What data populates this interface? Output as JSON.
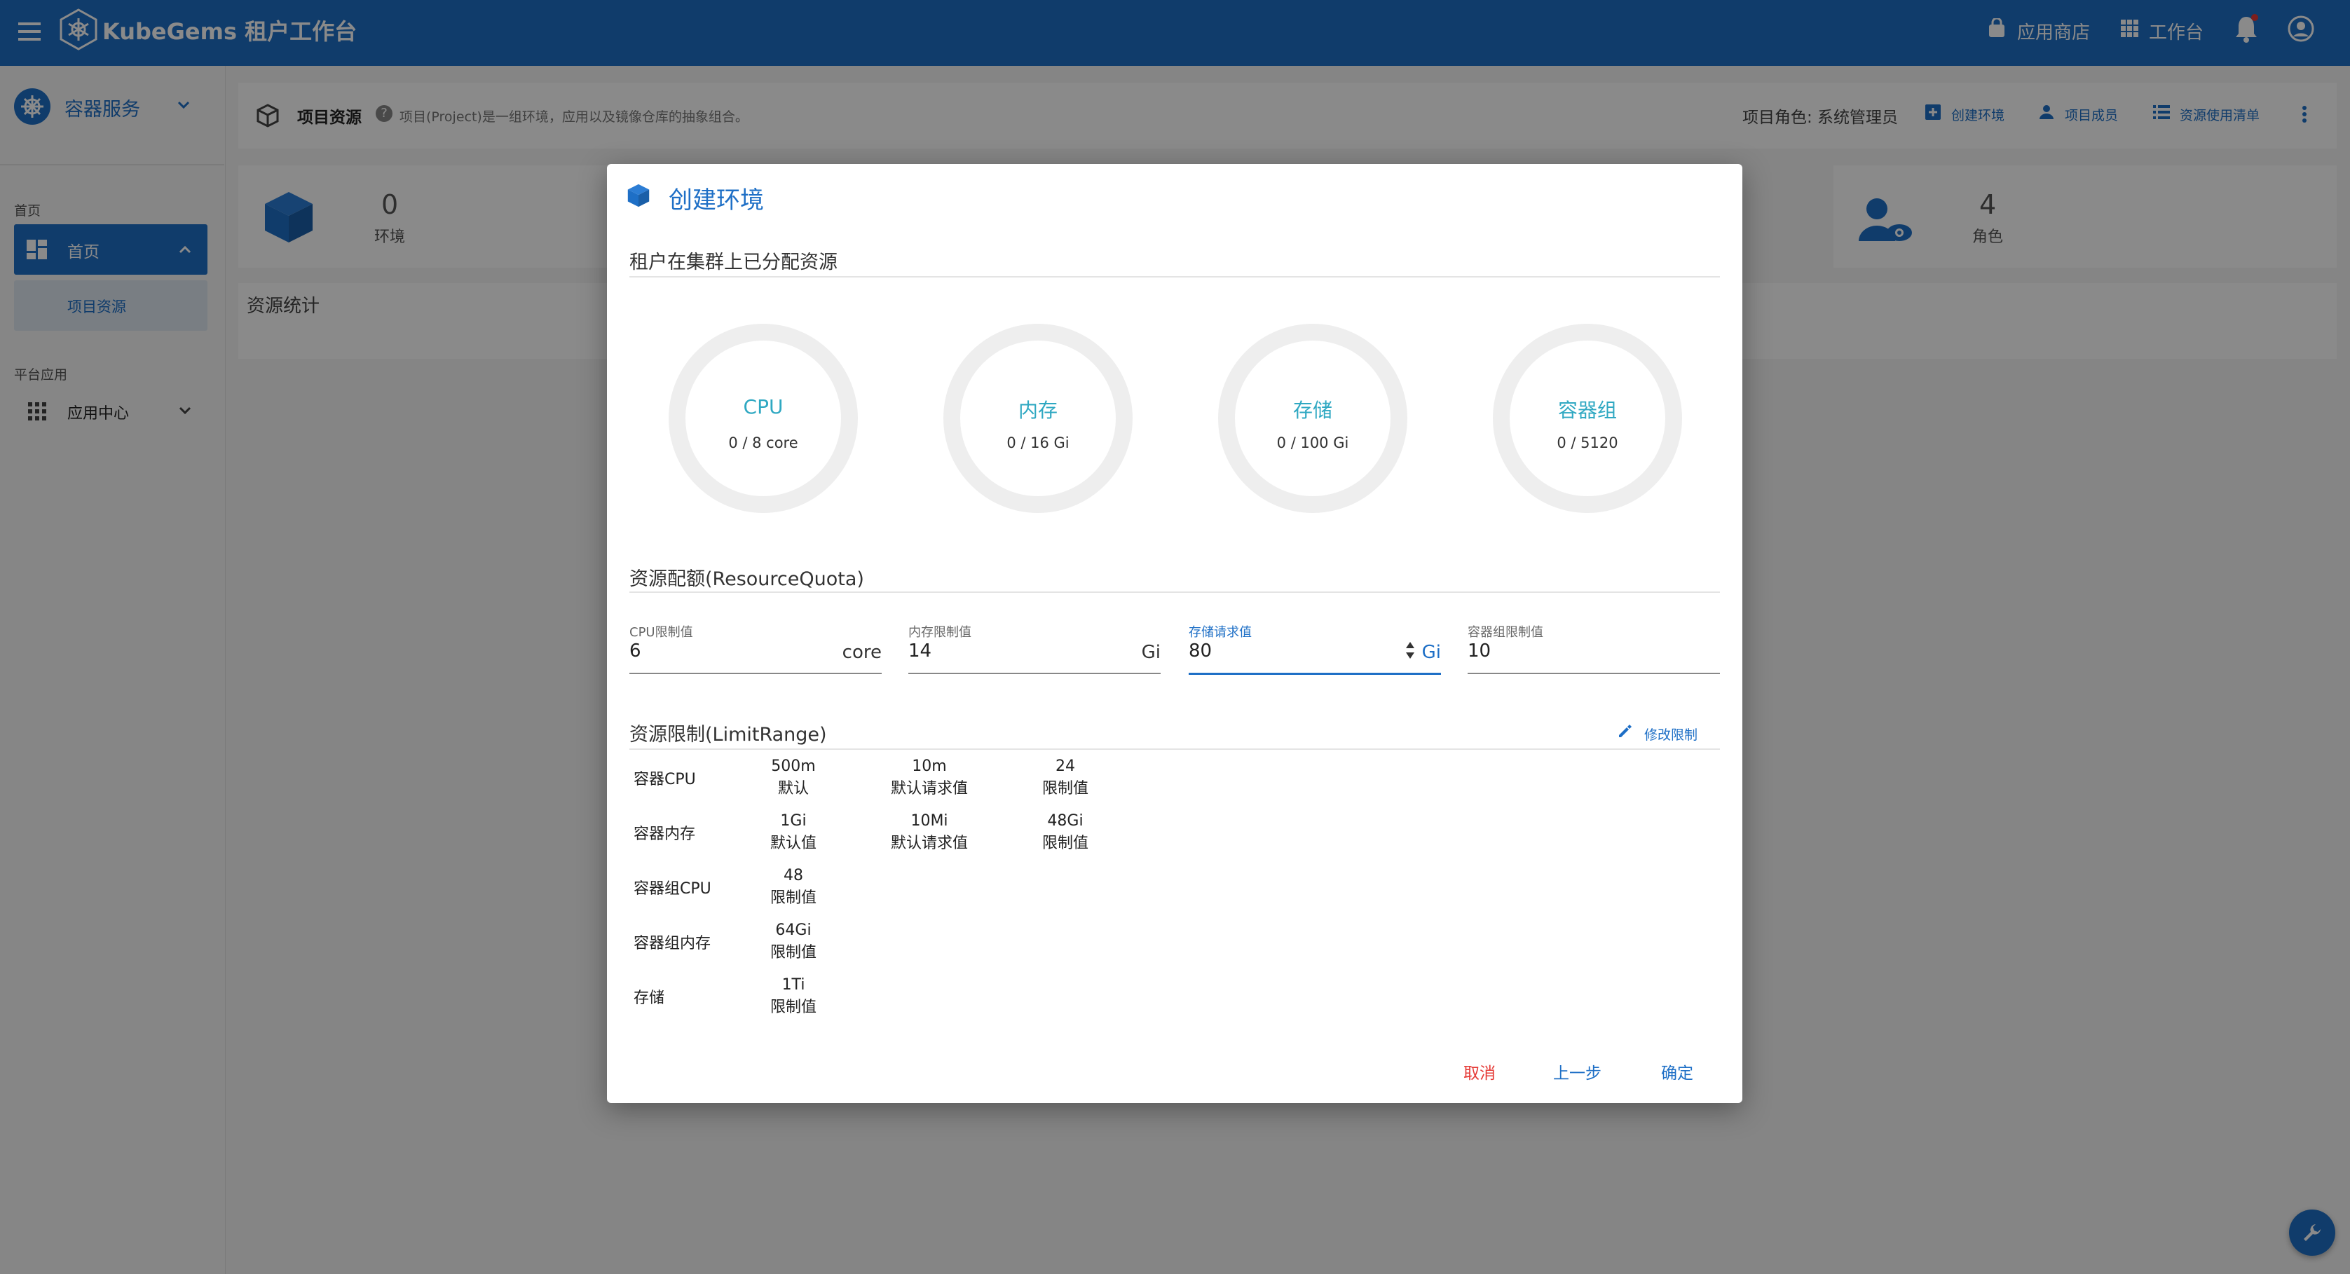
{
  "app": {
    "brand": "KubeGems 租户工作台",
    "app_store": "应用商店",
    "workbench": "工作台"
  },
  "sidebar": {
    "module": "容器服务",
    "home_section": "首页",
    "home_item": "首页",
    "home_sub_item": "项目资源",
    "platform_section": "平台应用",
    "app_center": "应用中心"
  },
  "header": {
    "title": "项目资源",
    "description": "项目(Project)是一组环境，应用以及镜像仓库的抽象组合。",
    "role": "项目角色: 系统管理员",
    "create_env": "创建环境",
    "members": "项目成员",
    "usage_list": "资源使用清单"
  },
  "stats": {
    "env_count": "0",
    "env_label": "环境",
    "role_count": "4",
    "role_label": "角色",
    "resource_stats": "资源统计"
  },
  "dialog": {
    "title": "创建环境",
    "allocated_title": "租户在集群上已分配资源",
    "gauges": [
      {
        "name": "CPU",
        "value": "0 / 8 core",
        "fraction": 0
      },
      {
        "name": "内存",
        "value": "0 / 16 Gi",
        "fraction": 0
      },
      {
        "name": "存储",
        "value": "0 / 100 Gi",
        "fraction": 0
      },
      {
        "name": "容器组",
        "value": "0 / 5120",
        "fraction": 0
      }
    ],
    "quota_title": "资源配额(ResourceQuota)",
    "fields": [
      {
        "label": "CPU限制值",
        "value": "6",
        "unit": "core"
      },
      {
        "label": "内存限制值",
        "value": "14",
        "unit": "Gi"
      },
      {
        "label": "存储请求值",
        "value": "80",
        "unit": "Gi"
      },
      {
        "label": "容器组限制值",
        "value": "10",
        "unit": ""
      }
    ],
    "limit_title": "资源限制(LimitRange)",
    "edit_limit": "修改限制",
    "limit_rows": [
      {
        "name": "容器CPU",
        "cells": [
          {
            "v": "500m",
            "l": "默认"
          },
          {
            "v": "10m",
            "l": "默认请求值"
          },
          {
            "v": "24",
            "l": "限制值"
          }
        ]
      },
      {
        "name": "容器内存",
        "cells": [
          {
            "v": "1Gi",
            "l": "默认值"
          },
          {
            "v": "10Mi",
            "l": "默认请求值"
          },
          {
            "v": "48Gi",
            "l": "限制值"
          }
        ]
      },
      {
        "name": "容器组CPU",
        "cells": [
          {
            "v": "48",
            "l": "限制值"
          }
        ]
      },
      {
        "name": "容器组内存",
        "cells": [
          {
            "v": "64Gi",
            "l": "限制值"
          }
        ]
      },
      {
        "name": "存储",
        "cells": [
          {
            "v": "1Ti",
            "l": "限制值"
          }
        ]
      }
    ],
    "cancel": "取消",
    "prev": "上一步",
    "confirm": "确定"
  },
  "colors": {
    "primary": "#1e6fc6",
    "gauge_label": "#2fa8c2",
    "cancel": "#e53935"
  }
}
